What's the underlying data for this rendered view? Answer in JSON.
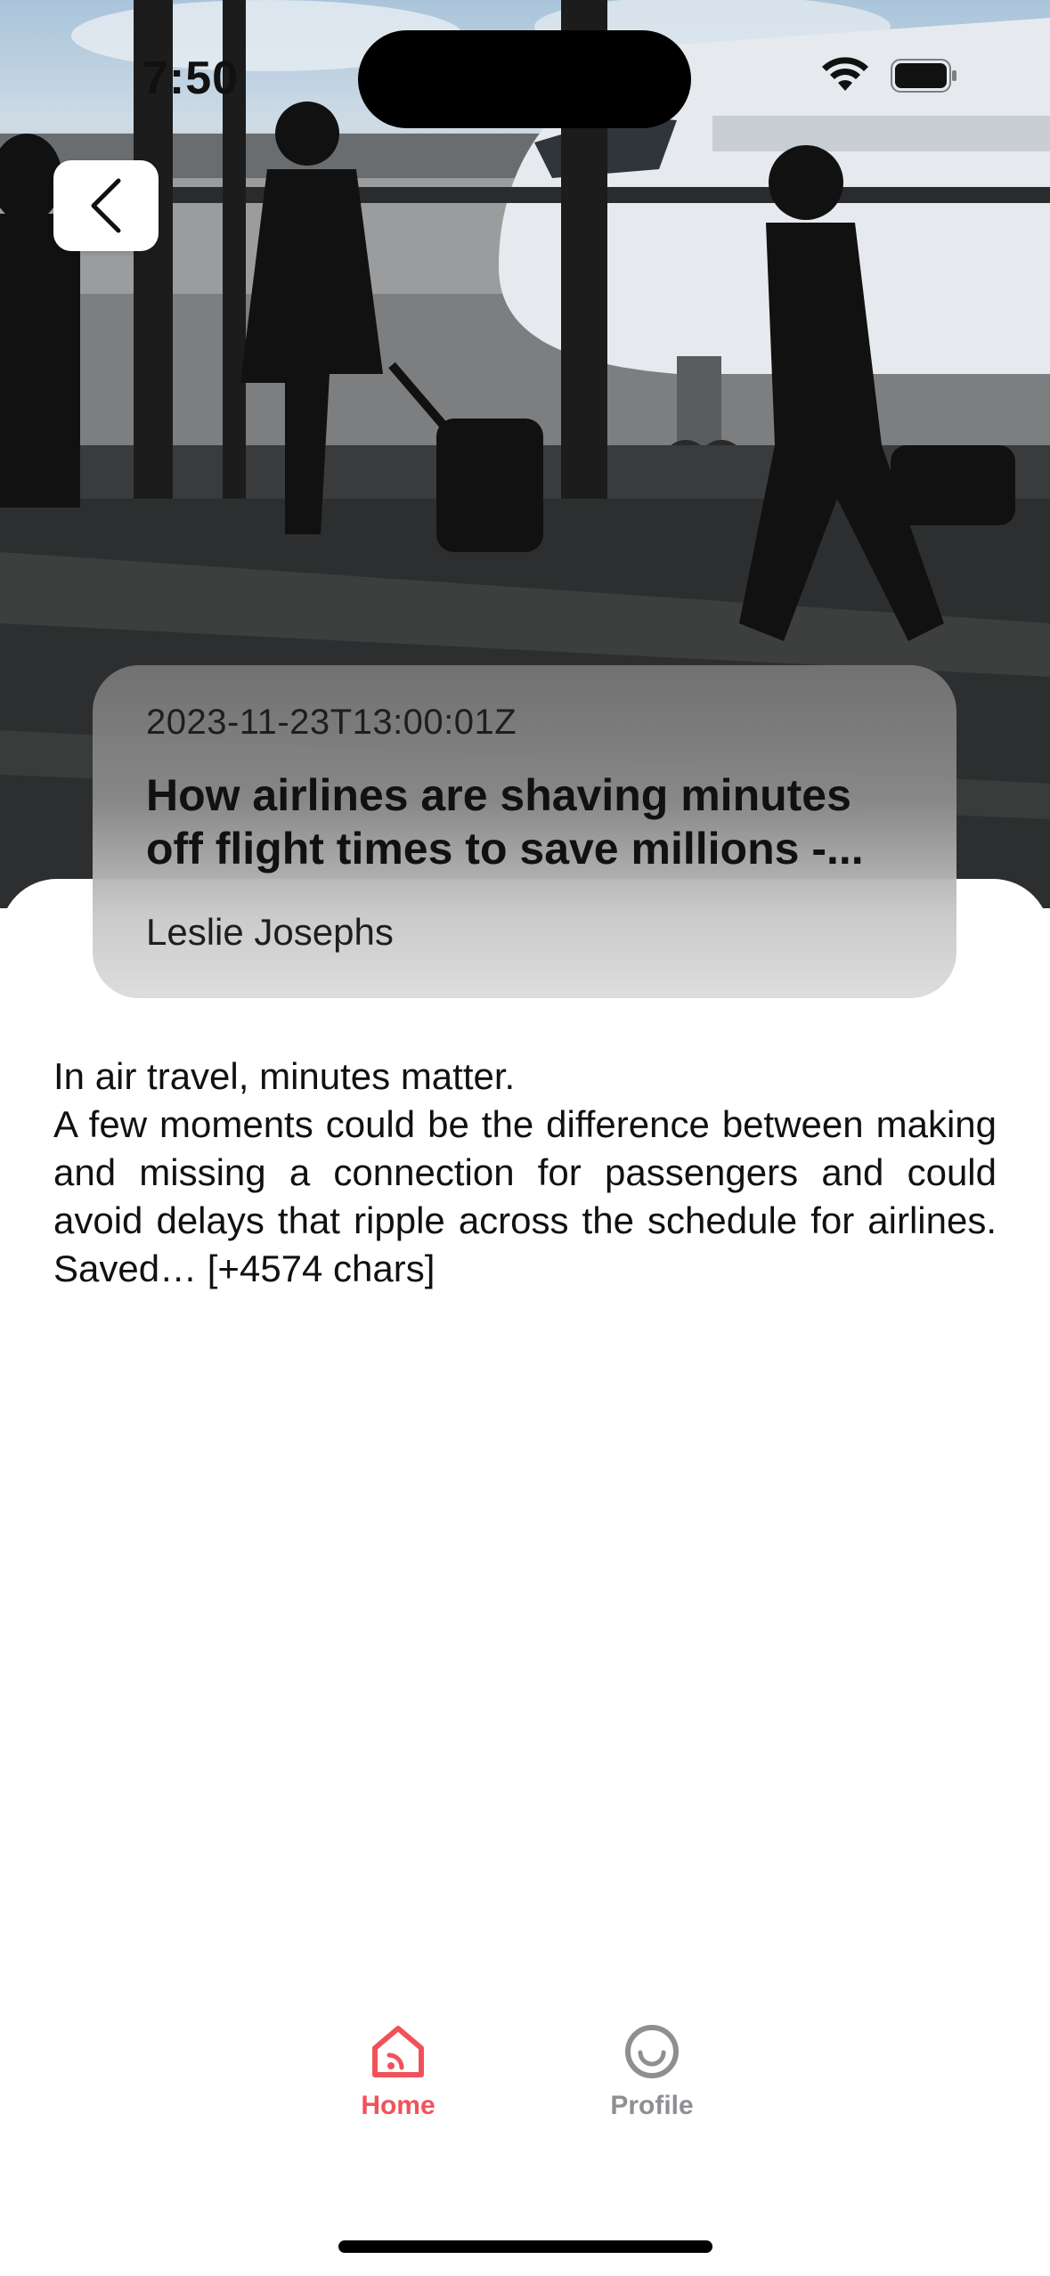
{
  "status_bar": {
    "time": "7:50"
  },
  "navigation": {
    "back_icon": "chevron-left-icon"
  },
  "article": {
    "published_at": "2023-11-23T13:00:01Z",
    "title": "How airlines are shaving minutes off flight times to save millions -...",
    "author": "Leslie Josephs",
    "lead": "In air travel, minutes matter.",
    "body": "A few moments could be the difference between making and missing a connection for passengers and could avoid delays that ripple across the schedule for airlines. Saved… [+4574 chars]"
  },
  "tab_bar": {
    "tabs": [
      {
        "label": "Home",
        "icon": "home-rss-icon",
        "active": true,
        "color": "#f0525a"
      },
      {
        "label": "Profile",
        "icon": "smiley-circle-icon",
        "active": false,
        "color": "#8e8e93"
      }
    ]
  }
}
